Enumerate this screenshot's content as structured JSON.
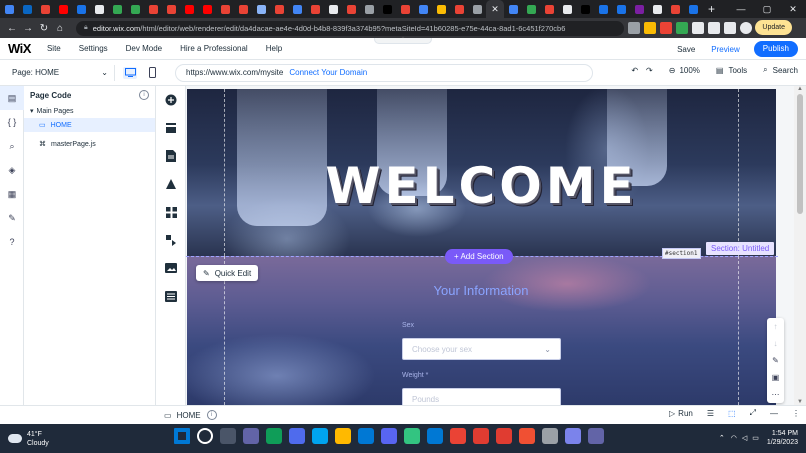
{
  "browser": {
    "tab_colors": [
      "#4285f4",
      "#0a66c2",
      "#ea4335",
      "#ff0000",
      "#1a73e8",
      "#e8eaed",
      "#34a853",
      "#34a853",
      "#ea4335",
      "#ea4335",
      "#ff0000",
      "#ff0000",
      "#ea4335",
      "#ea4335",
      "#8ab4f8",
      "#ea4335",
      "#4285f4",
      "#ea4335",
      "#e8eaed",
      "#ea4335",
      "#9aa0a6",
      "#000000",
      "#ea4335",
      "#4285f4",
      "#fbbc04",
      "#ea4335",
      "#9aa0a6",
      "#f28b82",
      "#4285f4",
      "#34a853",
      "#ea4335",
      "#e8eaed",
      "#000000",
      "#1a73e8",
      "#1a73e8",
      "#7b1fa2",
      "#e8eaed",
      "#ea4335",
      "#1a73e8"
    ],
    "url_host": "editor.wix.com",
    "url_path": "/html/editor/web/renderer/edit/da4dacae-ae4e-4d0d-b4b8-839f3a374b95?metaSiteId=41b60285-e75e-44ca-8ad1-6c451f270cb6",
    "update_label": "Update"
  },
  "wix": {
    "logo": "WiX",
    "menu": [
      "Site",
      "Settings",
      "Dev Mode",
      "Hire a Professional",
      "Help"
    ],
    "save": "Save",
    "preview": "Preview",
    "publish": "Publish",
    "page_selector": "Page: HOME",
    "site_url": "https://www.wix.com/mysite",
    "connect_domain": "Connect Your Domain",
    "zoom": "100%",
    "tools": "Tools",
    "search": "Search"
  },
  "code_panel": {
    "title": "Page Code",
    "main_pages": "Main Pages",
    "home": "HOME",
    "master": "masterPage.js"
  },
  "canvas": {
    "welcome": "WELCOME",
    "add_section": "+ Add Section",
    "section_tag": "#section1",
    "section_label": "Section: Untitled",
    "quick_edit": "Quick Edit",
    "form_title": "Your Information",
    "sex_label": "Sex",
    "sex_placeholder": "Choose your sex",
    "weight_label": "Weight *",
    "weight_placeholder": "Pounds"
  },
  "bottom_bar": {
    "page": "HOME",
    "run": "Run"
  },
  "taskbar": {
    "temp": "41°F",
    "condition": "Cloudy",
    "time": "1:54 PM",
    "date": "1/29/2023",
    "icon_colors": [
      "#0078d4",
      "#ffffff",
      "#4a5568",
      "#6264a7",
      "#0f9d58",
      "#4f6bed",
      "#00a4ef",
      "#ffb900",
      "#0078d4",
      "#5865f2",
      "#33c481",
      "#0078d4",
      "#ea4335",
      "#e03c31",
      "#e03c31",
      "#f05033",
      "#9aa0a6",
      "#7b83eb",
      "#6264a7"
    ]
  }
}
